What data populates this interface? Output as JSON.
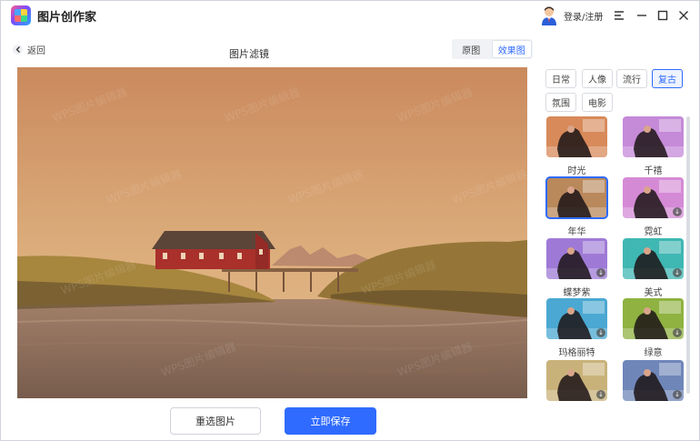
{
  "app": {
    "title": "图片创作家",
    "login_label": "登录/注册"
  },
  "header": {
    "back_label": "返回",
    "page_title": "图片滤镜",
    "view_toggle": [
      "原图",
      "效果图"
    ],
    "active_view": "效果图"
  },
  "categories": [
    "日常",
    "人像",
    "流行",
    "复古",
    "氛围",
    "电影"
  ],
  "active_category": "复古",
  "filters": [
    {
      "label": "时光",
      "tint": "#d88a5a",
      "downloadable": false
    },
    {
      "label": "千禧",
      "tint": "#c58ad8",
      "downloadable": false
    },
    {
      "label": "年华",
      "tint": "#b9895c",
      "downloadable": false,
      "selected": true
    },
    {
      "label": "霓虹",
      "tint": "#d58ad6",
      "downloadable": true
    },
    {
      "label": "蝶梦紫",
      "tint": "#9e7ad6",
      "downloadable": true
    },
    {
      "label": "美式",
      "tint": "#3fb7b3",
      "downloadable": true
    },
    {
      "label": "玛格丽特",
      "tint": "#4aa8d2",
      "downloadable": true
    },
    {
      "label": "绿意",
      "tint": "#8fb241",
      "downloadable": true
    },
    {
      "label": "",
      "tint": "#c9b27a",
      "downloadable": true
    },
    {
      "label": "",
      "tint": "#6f86b9",
      "downloadable": true
    }
  ],
  "actions": {
    "reselect_label": "重选图片",
    "save_label": "立即保存"
  },
  "watermark_text": "WPS图片编辑器"
}
